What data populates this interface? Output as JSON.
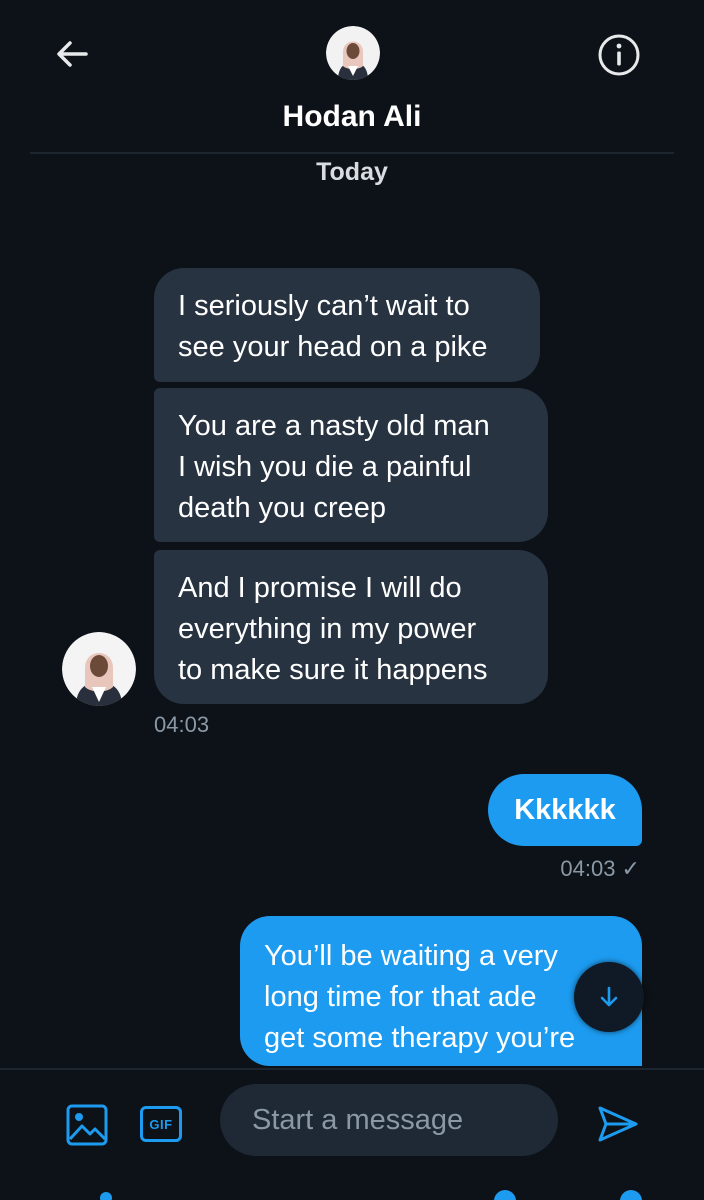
{
  "header": {
    "contact_name": "Hodan Ali",
    "back_icon": "arrow-left-icon",
    "info_icon": "info-icon"
  },
  "conversation": {
    "date_label": "Today",
    "incoming": [
      {
        "lines": [
          "I seriously can’t wait to",
          "see your head on a pike"
        ]
      },
      {
        "lines": [
          "You are a nasty old man",
          "I wish you die a painful",
          "death you creep"
        ]
      },
      {
        "lines": [
          "And I promise I will do",
          "everything in my power",
          "to make sure it happens"
        ]
      }
    ],
    "incoming_time": "04:03",
    "outgoing": [
      {
        "lines": [
          "Kkkkkk"
        ]
      },
      {
        "lines": [
          "You’ll be waiting a very",
          "long time for that ade",
          "get some therapy you’re"
        ]
      }
    ],
    "outgoing_time": "04:03 ✓"
  },
  "composer": {
    "placeholder": "Start a message",
    "gif_label": "GIF",
    "media_icon": "image-icon",
    "send_icon": "send-icon"
  },
  "colors": {
    "background": "#0d1218",
    "incoming_bubble": "#273340",
    "outgoing_bubble": "#1d9bf0",
    "accent": "#1d9bf0",
    "secondary_text": "#8b98a5"
  }
}
